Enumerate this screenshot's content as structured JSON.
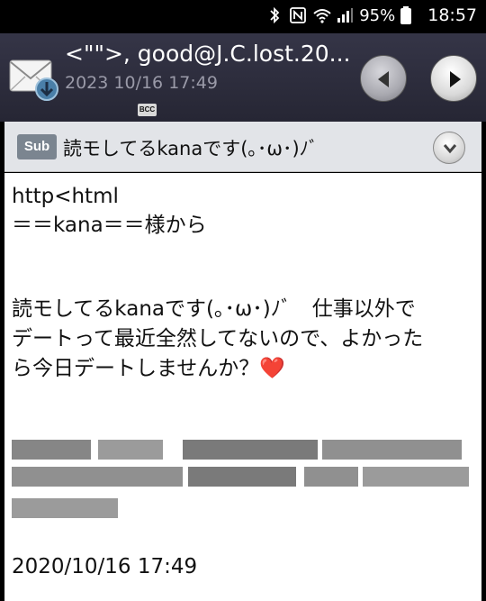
{
  "status_bar": {
    "battery_percent": "95%",
    "time": "18:57",
    "icons": [
      "bluetooth-icon",
      "nfc-icon",
      "wifi-icon",
      "signal-icon",
      "battery-icon"
    ]
  },
  "header": {
    "from": "<\"\">, good@J.C.lost.20...",
    "date": "2023 10/16 17:49",
    "bcc_label": "BCC"
  },
  "subject": {
    "badge": "Sub",
    "text": "読モしてるkanaです(｡･ω･)ﾉﾞ"
  },
  "body": {
    "lines": [
      "http<html",
      "＝＝kana＝＝様から",
      "読モしてるkanaです(｡･ω･)ﾉﾞ　仕事以外で",
      "デートって最近全然してないので、よかった",
      "ら今日デートしませんか？"
    ],
    "heart": "❤️",
    "footer_date": "2020/10/16 17:49"
  },
  "colors": {
    "header_bg": "#2d2d3c",
    "subject_bg": "#e2e4e8",
    "sub_badge": "#7b8590",
    "heart": "#e0242f"
  }
}
